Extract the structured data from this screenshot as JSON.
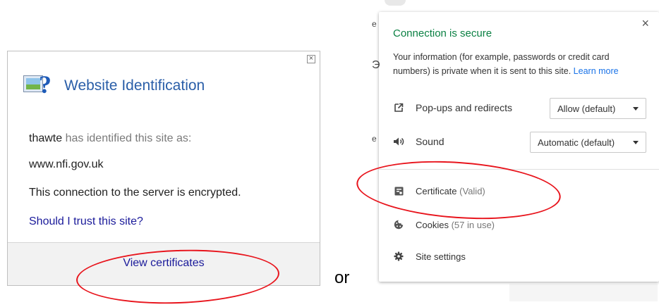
{
  "ie": {
    "title": "Website Identification",
    "close_glyph": "×",
    "issuer": "thawte",
    "identified_text": "has identified this site as:",
    "site": "www.nfi.gov.uk",
    "encrypted_text": "This connection to the server is encrypted.",
    "trust_link": "Should I trust this site?",
    "view_certificates": "View certificates"
  },
  "separator_word": "or",
  "chrome": {
    "title": "Connection is secure",
    "info_text": "Your information (for example, passwords or credit card numbers) is private when it is sent to this site.",
    "learn_more": "Learn more",
    "close_glyph": "×",
    "popups_label": "Pop-ups and redirects",
    "popups_value": "Allow (default)",
    "sound_label": "Sound",
    "sound_value": "Automatic (default)",
    "certificate_label": "Certificate",
    "certificate_status": "(Valid)",
    "cookies_label": "Cookies",
    "cookies_count": "(57 in use)",
    "site_settings_label": "Site settings"
  },
  "colors": {
    "secure_green": "#0b8043",
    "link_blue": "#1a73e8",
    "annotation_red": "#e8141c",
    "ie_title_blue": "#2a5ea8"
  }
}
